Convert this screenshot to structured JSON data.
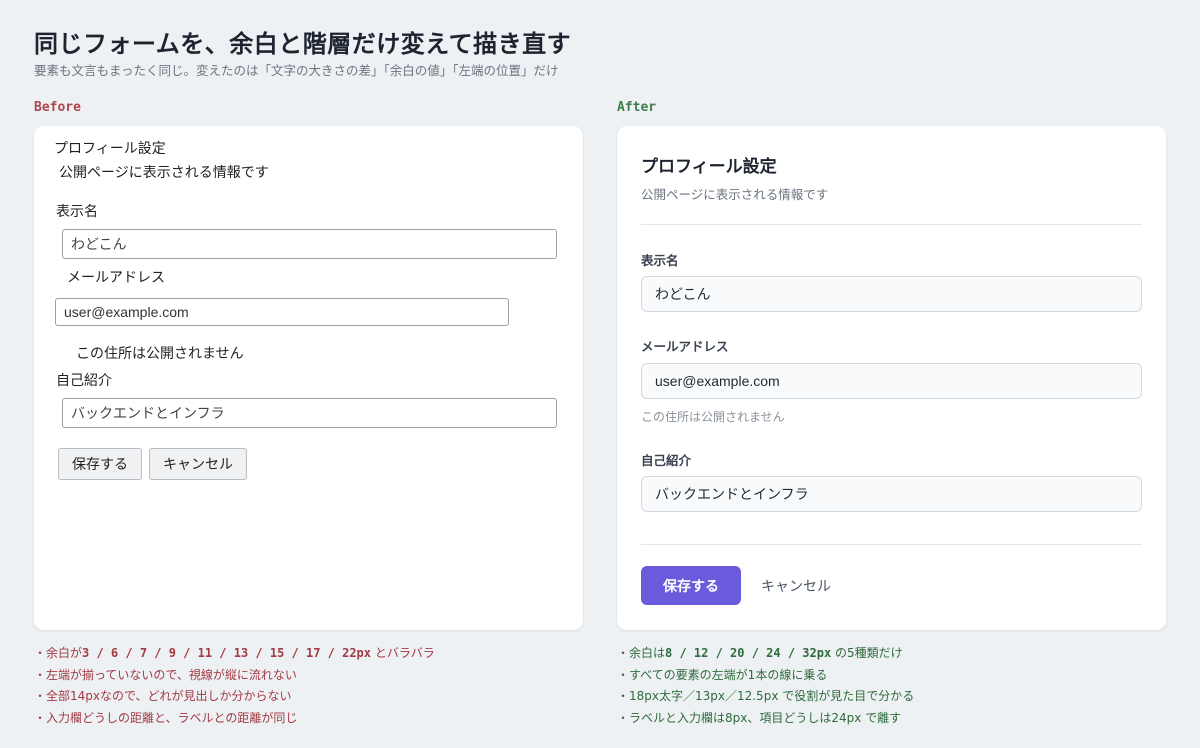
{
  "header": {
    "title": "同じフォームを、余白と階層だけ変えて描き直す",
    "subtitle": "要素も文言もまったく同じ。変えたのは「文字の大きさの差」「余白の値」「左端の位置」だけ"
  },
  "before": {
    "label": "Before",
    "form": {
      "title": "プロフィール設定",
      "subtitle": "公開ページに表示される情報です",
      "name_label": "表示名",
      "name_value": "わどこん",
      "email_label": "メールアドレス",
      "email_value": "user@example.com",
      "email_hint": "この住所は公開されません",
      "bio_label": "自己紹介",
      "bio_value": "バックエンドとインフラ",
      "save_label": "保存する",
      "cancel_label": "キャンセル"
    },
    "notes": {
      "n1_pre": "・余白が",
      "n1_values": "3 / 6 / 7 / 9 / 11 / 13 / 15 / 17 / 22px",
      "n1_post": "とバラバラ",
      "n2": "・左端が揃っていないので、視線が縦に流れない",
      "n3": "・全部14pxなので、どれが見出しか分からない",
      "n4": "・入力欄どうしの距離と、ラベルとの距離が同じ"
    }
  },
  "after": {
    "label": "After",
    "form": {
      "title": "プロフィール設定",
      "subtitle": "公開ページに表示される情報です",
      "name_label": "表示名",
      "name_value": "わどこん",
      "email_label": "メールアドレス",
      "email_value": "user@example.com",
      "email_hint": "この住所は公開されません",
      "bio_label": "自己紹介",
      "bio_value": "バックエンドとインフラ",
      "save_label": "保存する",
      "cancel_label": "キャンセル"
    },
    "notes": {
      "n1_pre": "・余白は",
      "n1_values": "8 / 12 / 20 / 24 / 32px",
      "n1_post": "の5種類だけ",
      "n2": "・すべての要素の左端が1本の線に乗る",
      "n3": "・18px太字／13px／12.5px で役割が見た目で分かる",
      "n4": "・ラベルと入力欄は8px、項目どうしは24px で離す"
    }
  },
  "colors": {
    "background": "#eef1f4",
    "before_accent": "#b0454c",
    "after_accent": "#3f7d4c",
    "primary_button": "#6a5bdc"
  }
}
